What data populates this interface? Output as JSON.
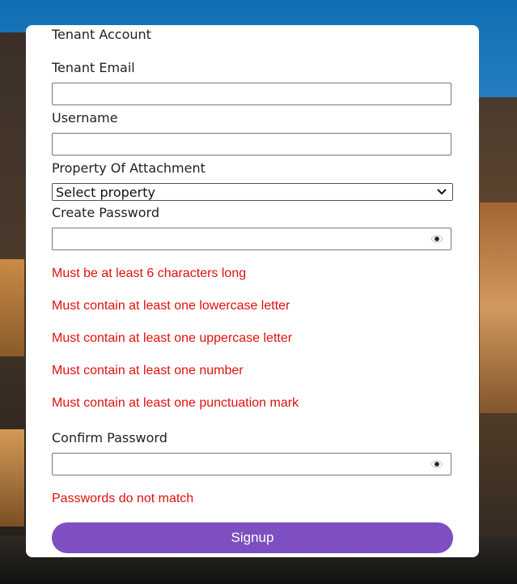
{
  "form": {
    "title": "Tenant Account",
    "tenant_email_label": "Tenant Email",
    "tenant_email_value": "",
    "username_label": "Username",
    "username_value": "",
    "property_label": "Property Of Attachment",
    "property_selected": "Select property",
    "create_password_label": "Create Password",
    "create_password_value": "",
    "password_rules": [
      "Must be at least 6 characters long",
      "Must contain at least one lowercase letter",
      "Must contain at least one uppercase letter",
      "Must contain at least one number",
      "Must contain at least one punctuation mark"
    ],
    "confirm_password_label": "Confirm Password",
    "confirm_password_value": "",
    "confirm_error": "Passwords do not match",
    "signup_label": "Signup"
  },
  "icons": {
    "password_toggle": "eye-icon",
    "select_arrow": "chevron-down-icon"
  },
  "colors": {
    "error": "#e01010",
    "primary_button": "#7e4fc0"
  }
}
